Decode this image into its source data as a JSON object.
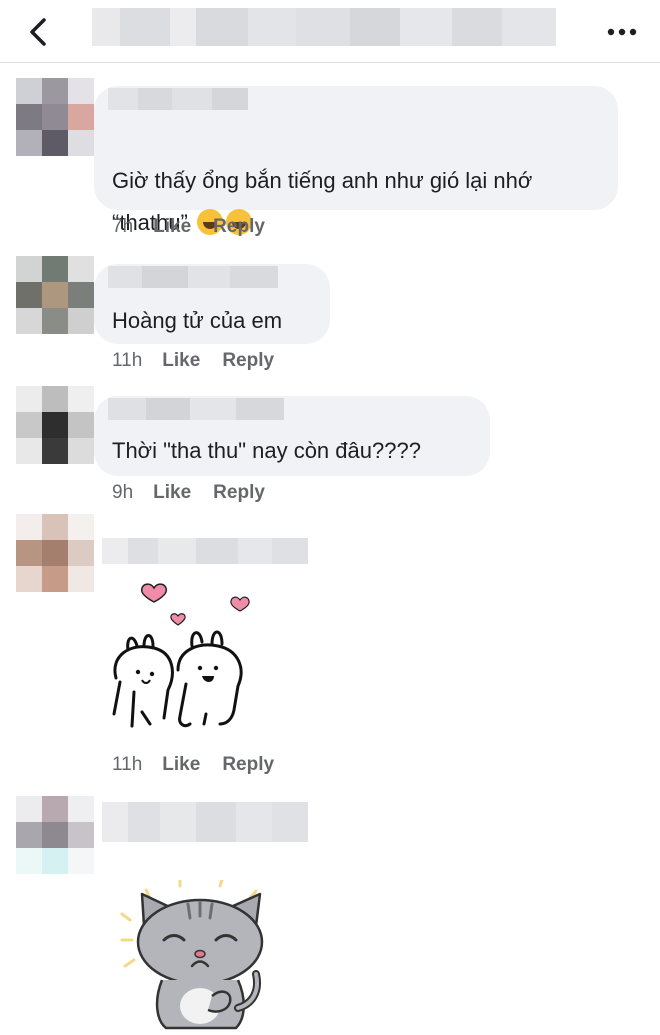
{
  "header": {
    "back_icon": "chevron-left-icon",
    "more_icon": "more-horizontal-icon"
  },
  "comments": [
    {
      "text": "Giờ thấy ổng bắn tiếng anh như gió lại nhớ\n“thathu” ",
      "emoji": [
        "rolling-on-floor-laughing-icon",
        "rolling-on-floor-laughing-icon"
      ],
      "time": "7h",
      "like_label": "Like",
      "reply_label": "Reply"
    },
    {
      "text": "Hoàng tử của em",
      "time": "11h",
      "like_label": "Like",
      "reply_label": "Reply"
    },
    {
      "text": "Thời \"tha thu\" nay còn đâu????",
      "time": "9h",
      "like_label": "Like",
      "reply_label": "Reply"
    },
    {
      "sticker": "hugging-rabbits-with-hearts-sticker",
      "time": "11h",
      "like_label": "Like",
      "reply_label": "Reply"
    },
    {
      "sticker": "smug-gray-cat-sticker"
    }
  ],
  "colors": {
    "bubble": "#f0f2f5",
    "meta_text": "#65676b",
    "heart": "#f08ca8"
  }
}
